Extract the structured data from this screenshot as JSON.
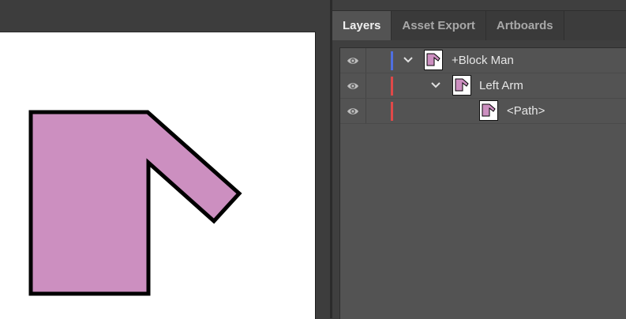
{
  "tabs": [
    {
      "label": "Layers",
      "active": true
    },
    {
      "label": "Asset Export",
      "active": false
    },
    {
      "label": "Artboards",
      "active": false
    }
  ],
  "layers": [
    {
      "name": "+Block Man",
      "color": "#4f6fe0",
      "expanded": true,
      "visible": true,
      "icon": "chevron-down-icon"
    },
    {
      "name": "Left Arm",
      "color": "#e04848",
      "expanded": true,
      "visible": true,
      "icon": "chevron-down-icon"
    },
    {
      "name": "<Path>",
      "color": "#e04848",
      "expanded": false,
      "visible": true,
      "icon": "none"
    }
  ],
  "colors": {
    "shape_fill": "#cc8fc0",
    "shape_stroke": "#000000",
    "panel_bg": "#535353",
    "app_bg": "#3d3d3d"
  },
  "icons": {
    "visibility": "eye-icon",
    "expand": "chevron-down-icon"
  }
}
